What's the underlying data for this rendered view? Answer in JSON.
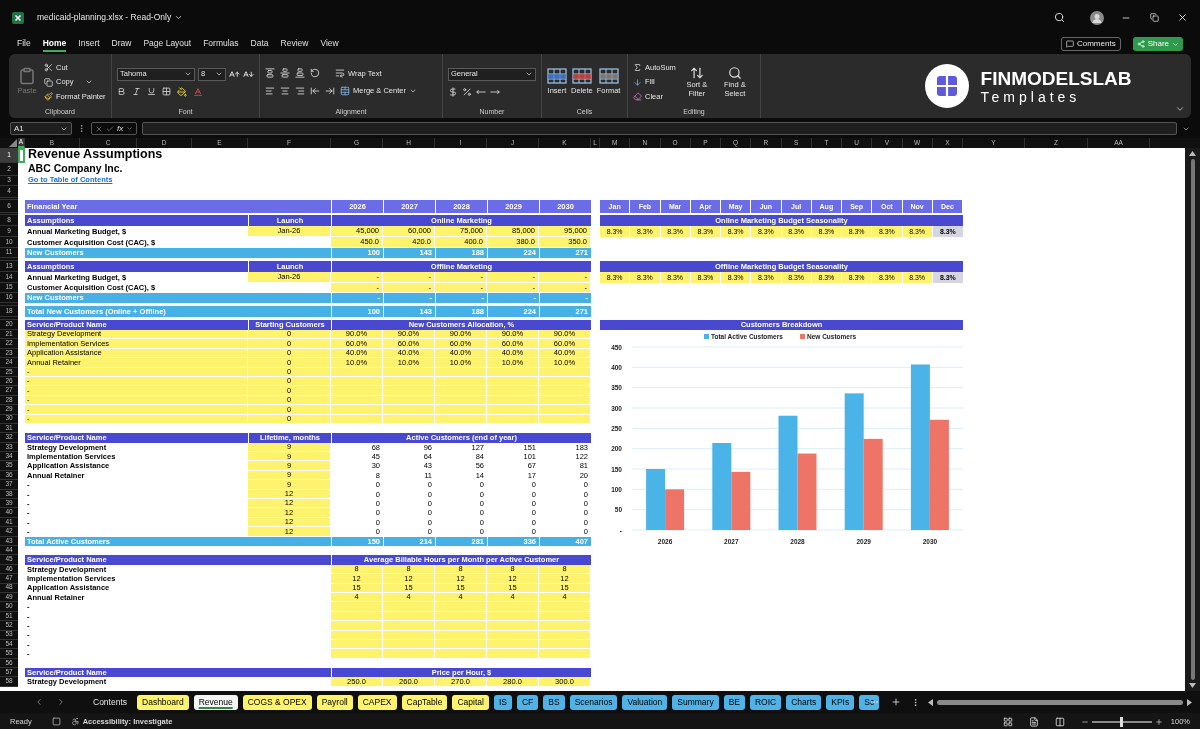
{
  "window": {
    "title": "medicaid-planning.xlsx - Read-Only"
  },
  "menu_tabs": [
    {
      "label": "File",
      "selected": false
    },
    {
      "label": "Home",
      "selected": true
    },
    {
      "label": "Insert",
      "selected": false
    },
    {
      "label": "Draw",
      "selected": false
    },
    {
      "label": "Page Layout",
      "selected": false
    },
    {
      "label": "Formulas",
      "selected": false
    },
    {
      "label": "Data",
      "selected": false
    },
    {
      "label": "Review",
      "selected": false
    },
    {
      "label": "View",
      "selected": false
    }
  ],
  "header_buttons": {
    "comments": "Comments",
    "share": "Share"
  },
  "ribbon": {
    "clipboard": {
      "label": "Clipboard",
      "paste": "Paste",
      "cut": "Cut",
      "copy": "Copy",
      "format_painter": "Format Painter"
    },
    "font": {
      "label": "Font",
      "font_name": "Tahoma",
      "font_size": "8"
    },
    "alignment": {
      "label": "Alignment",
      "wrap": "Wrap Text",
      "merge": "Merge & Center"
    },
    "number": {
      "label": "Number",
      "format": "General"
    },
    "cells": {
      "label": "Cells",
      "buttons": [
        "Insert",
        "Delete",
        "Format"
      ]
    },
    "editing": {
      "label": "Editing",
      "autosum": "AutoSum",
      "fill": "Fill",
      "clear": "Clear",
      "sort": "Sort & Filter",
      "find": "Find & Select"
    }
  },
  "logo": {
    "name": "FINMODELSLAB",
    "tagline": "Templates"
  },
  "formula_bar": {
    "name_box": "A1",
    "function_button": "fx"
  },
  "columns": [
    {
      "letter": "A",
      "selected": true
    },
    {
      "letter": "B",
      "selected": false
    },
    {
      "letter": "C",
      "selected": false
    },
    {
      "letter": "D",
      "selected": false
    },
    {
      "letter": "E",
      "selected": false
    },
    {
      "letter": "F",
      "selected": false
    },
    {
      "letter": "G",
      "selected": false
    },
    {
      "letter": "H",
      "selected": false
    },
    {
      "letter": "I",
      "selected": false
    },
    {
      "letter": "J",
      "selected": false
    },
    {
      "letter": "K",
      "selected": false
    },
    {
      "letter": "L",
      "selected": false
    },
    {
      "letter": "M",
      "selected": false
    },
    {
      "letter": "N",
      "selected": false
    },
    {
      "letter": "O",
      "selected": false
    },
    {
      "letter": "P",
      "selected": false
    },
    {
      "letter": "Q",
      "selected": false
    },
    {
      "letter": "R",
      "selected": false
    },
    {
      "letter": "S",
      "selected": false
    },
    {
      "letter": "T",
      "selected": false
    },
    {
      "letter": "U",
      "selected": false
    },
    {
      "letter": "V",
      "selected": false
    },
    {
      "letter": "W",
      "selected": false
    },
    {
      "letter": "X",
      "selected": false
    },
    {
      "letter": "Y",
      "selected": false
    },
    {
      "letter": "Z",
      "selected": false
    },
    {
      "letter": "AA",
      "selected": false
    }
  ],
  "rows": [
    {
      "number": "1",
      "selected": true,
      "kind": "title",
      "text": "Revenue Assumptions"
    },
    {
      "number": "2",
      "selected": false,
      "kind": "subtitle",
      "text": "ABC Company Inc."
    },
    {
      "number": "3",
      "selected": false,
      "kind": "link",
      "text": "Go to Table of Contents"
    },
    {
      "number": "4",
      "selected": false,
      "kind": "blank"
    },
    {
      "selected": false,
      "kind": "hidden"
    },
    {
      "number": "6",
      "selected": false,
      "kind": "year_bar",
      "label": "Financial Year",
      "values": [
        "2026",
        "2027",
        "2028",
        "2029",
        "2030"
      ],
      "right": {
        "kind": "months",
        "values": [
          "Jan",
          "Feb",
          "Mar",
          "Apr",
          "May",
          "Jun",
          "Jul",
          "Aug",
          "Sep",
          "Oct",
          "Nov",
          "Dec"
        ]
      }
    },
    {
      "selected": false,
      "kind": "hidden"
    },
    {
      "number": "8",
      "selected": false,
      "kind": "header",
      "label": "Assumptions",
      "f": "Launch",
      "title": "Online Marketing",
      "right": {
        "kind": "title",
        "text": "Online Marketing Budget Seasonality"
      }
    },
    {
      "number": "9",
      "selected": false,
      "kind": "input",
      "label": "Annual Marketing Budget, $",
      "f": "Jan-26",
      "values": [
        "45,000",
        "60,000",
        "75,000",
        "85,000",
        "95,000"
      ],
      "right": {
        "kind": "seasonality",
        "values": [
          "8.3%",
          "8.3%",
          "8.3%",
          "8.3%",
          "8.3%",
          "8.3%",
          "8.3%",
          "8.3%",
          "8.3%",
          "8.3%",
          "8.3%"
        ],
        "balance": "8.3%"
      }
    },
    {
      "number": "10",
      "selected": false,
      "kind": "input",
      "label": "Customer Acquisition Cost (CAC), $",
      "values": [
        "450.0",
        "420.0",
        "400.0",
        "380.0",
        "350.0"
      ]
    },
    {
      "number": "11",
      "selected": false,
      "kind": "total",
      "label": "New Customers",
      "values": [
        "100",
        "143",
        "188",
        "224",
        "271"
      ]
    },
    {
      "selected": false,
      "kind": "hidden"
    },
    {
      "number": "13",
      "selected": false,
      "kind": "header",
      "label": "Assumptions",
      "f": "Launch",
      "title": "Offline Marketing",
      "right": {
        "kind": "title",
        "text": "Offline Marketing Budget Seasonality"
      }
    },
    {
      "number": "14",
      "selected": false,
      "kind": "input",
      "label": "Annual Marketing Budget, $",
      "f": "Jan-26",
      "values": [
        "-",
        "-",
        "-",
        "-",
        "-"
      ],
      "right": {
        "kind": "seasonality",
        "values": [
          "8.3%",
          "8.3%",
          "8.3%",
          "8.3%",
          "8.3%",
          "8.3%",
          "8.3%",
          "8.3%",
          "8.3%",
          "8.3%",
          "8.3%"
        ],
        "balance": "8.3%"
      }
    },
    {
      "number": "15",
      "selected": false,
      "kind": "input",
      "label": "Customer Acquisition Cost (CAC), $",
      "values": [
        "-",
        "-",
        "-",
        "-",
        "-"
      ]
    },
    {
      "number": "16",
      "selected": false,
      "kind": "total",
      "label": "New Customers",
      "values": [
        "-",
        "-",
        "-",
        "-",
        "-"
      ]
    },
    {
      "selected": false,
      "kind": "hidden"
    },
    {
      "number": "18",
      "selected": false,
      "kind": "total",
      "label": "Total New Customers (Online + Offline)",
      "values": [
        "100",
        "143",
        "188",
        "224",
        "271"
      ]
    },
    {
      "selected": false,
      "kind": "hidden"
    },
    {
      "number": "20",
      "selected": false,
      "kind": "header",
      "label": "Service/Product Name",
      "f": "Starting Customers",
      "title": "New Customers Allocation, %",
      "right": {
        "kind": "title",
        "text": "Customers Breakdown"
      }
    },
    {
      "number": "21",
      "selected": false,
      "kind": "alloc",
      "label": "Strategy Development",
      "f": "0",
      "values": [
        "90.0%",
        "90.0%",
        "90.0%",
        "90.0%",
        "90.0%"
      ]
    },
    {
      "number": "22",
      "selected": false,
      "kind": "alloc",
      "label": "Implementation Services",
      "f": "0",
      "values": [
        "60.0%",
        "60.0%",
        "60.0%",
        "60.0%",
        "60.0%"
      ]
    },
    {
      "number": "23",
      "selected": false,
      "kind": "alloc",
      "label": "Application Assistance",
      "f": "0",
      "values": [
        "40.0%",
        "40.0%",
        "40.0%",
        "40.0%",
        "40.0%"
      ]
    },
    {
      "number": "24",
      "selected": false,
      "kind": "alloc",
      "label": "Annual Retainer",
      "f": "0",
      "values": [
        "10.0%",
        "10.0%",
        "10.0%",
        "10.0%",
        "10.0%"
      ]
    },
    {
      "number": "25",
      "selected": false,
      "kind": "alloc",
      "label": "-",
      "f": "0"
    },
    {
      "number": "26",
      "selected": false,
      "kind": "alloc",
      "label": "-",
      "f": "0"
    },
    {
      "number": "27",
      "selected": false,
      "kind": "alloc",
      "label": "-",
      "f": "0"
    },
    {
      "number": "28",
      "selected": false,
      "kind": "alloc",
      "label": "-",
      "f": "0"
    },
    {
      "number": "29",
      "selected": false,
      "kind": "alloc",
      "label": "-",
      "f": "0"
    },
    {
      "number": "30",
      "selected": false,
      "kind": "alloc",
      "label": "-",
      "f": "0"
    },
    {
      "number": "31",
      "selected": false,
      "kind": "blank"
    },
    {
      "number": "32",
      "selected": false,
      "kind": "header",
      "label": "Service/Product Name",
      "f": "Lifetime, months",
      "title": "Active Customers (end of year)"
    },
    {
      "number": "33",
      "selected": false,
      "kind": "active",
      "label": "Strategy Development",
      "f": "9",
      "values": [
        "68",
        "96",
        "127",
        "151",
        "183"
      ]
    },
    {
      "number": "34",
      "selected": false,
      "kind": "active",
      "label": "Implementation Services",
      "f": "9",
      "values": [
        "45",
        "64",
        "84",
        "101",
        "122"
      ]
    },
    {
      "number": "35",
      "selected": false,
      "kind": "active",
      "label": "Application Assistance",
      "f": "9",
      "values": [
        "30",
        "43",
        "56",
        "67",
        "81"
      ]
    },
    {
      "number": "36",
      "selected": false,
      "kind": "active",
      "label": "Annual Retainer",
      "f": "9",
      "values": [
        "8",
        "11",
        "14",
        "17",
        "20"
      ]
    },
    {
      "number": "37",
      "selected": false,
      "kind": "active",
      "label": "-",
      "f": "9",
      "values": [
        "0",
        "0",
        "0",
        "0",
        "0"
      ]
    },
    {
      "number": "38",
      "selected": false,
      "kind": "active",
      "label": "-",
      "f": "12",
      "values": [
        "0",
        "0",
        "0",
        "0",
        "0"
      ]
    },
    {
      "number": "39",
      "selected": false,
      "kind": "active",
      "label": "-",
      "f": "12",
      "values": [
        "0",
        "0",
        "0",
        "0",
        "0"
      ]
    },
    {
      "number": "40",
      "selected": false,
      "kind": "active",
      "label": "-",
      "f": "12",
      "values": [
        "0",
        "0",
        "0",
        "0",
        "0"
      ]
    },
    {
      "number": "41",
      "selected": false,
      "kind": "active",
      "label": "-",
      "f": "12",
      "values": [
        "0",
        "0",
        "0",
        "0",
        "0"
      ]
    },
    {
      "number": "42",
      "selected": false,
      "kind": "active",
      "label": "-",
      "f": "12",
      "values": [
        "0",
        "0",
        "0",
        "0",
        "0"
      ]
    },
    {
      "number": "43",
      "selected": false,
      "kind": "total",
      "label": "Total Active Customers",
      "values": [
        "150",
        "214",
        "281",
        "336",
        "407"
      ]
    },
    {
      "number": "44",
      "selected": false,
      "kind": "blank"
    },
    {
      "number": "45",
      "selected": false,
      "kind": "header",
      "label": "Service/Product Name",
      "title": "Average Billable Hours per Month per Active Customer"
    },
    {
      "number": "46",
      "selected": false,
      "kind": "hours",
      "label": "Strategy Development",
      "values": [
        "8",
        "8",
        "8",
        "8",
        "8"
      ]
    },
    {
      "number": "47",
      "selected": false,
      "kind": "hours",
      "label": "Implementation Services",
      "values": [
        "12",
        "12",
        "12",
        "12",
        "12"
      ]
    },
    {
      "number": "48",
      "selected": false,
      "kind": "hours",
      "label": "Application Assistance",
      "values": [
        "15",
        "15",
        "15",
        "15",
        "15"
      ]
    },
    {
      "number": "49",
      "selected": false,
      "kind": "hours",
      "label": "Annual Retainer",
      "values": [
        "4",
        "4",
        "4",
        "4",
        "4"
      ]
    },
    {
      "number": "50",
      "selected": false,
      "kind": "hours",
      "label": "-"
    },
    {
      "number": "51",
      "selected": false,
      "kind": "hours",
      "label": "-"
    },
    {
      "number": "52",
      "selected": false,
      "kind": "hours",
      "label": "-"
    },
    {
      "number": "53",
      "selected": false,
      "kind": "hours",
      "label": "-"
    },
    {
      "number": "54",
      "selected": false,
      "kind": "hours",
      "label": "-"
    },
    {
      "number": "55",
      "selected": false,
      "kind": "hours",
      "label": "-"
    },
    {
      "number": "56",
      "selected": false,
      "kind": "blank"
    },
    {
      "number": "57",
      "selected": false,
      "kind": "header",
      "label": "Service/Product Name",
      "title": "Price per Hour, $"
    },
    {
      "number": "58",
      "selected": false,
      "kind": "hours",
      "label": "Strategy Development",
      "values": [
        "250.0",
        "260.0",
        "270.0",
        "280.0",
        "300.0"
      ]
    }
  ],
  "chart": {
    "chart_data": {
      "type": "bar",
      "categories": [
        "2026",
        "2027",
        "2028",
        "2029",
        "2030"
      ],
      "series": [
        {
          "name": "Total Active Customers",
          "color": "#4ab3e8",
          "values": [
            150,
            214,
            281,
            336,
            407
          ]
        },
        {
          "name": "New Customers",
          "color": "#ef7468",
          "values": [
            100,
            143,
            188,
            224,
            271
          ]
        }
      ],
      "ylim": [
        0,
        450
      ],
      "grid": true,
      "legend": true,
      "yticks": [
        {
          "value": 0,
          "label": "-"
        },
        {
          "value": 50,
          "label": "50"
        },
        {
          "value": 100,
          "label": "100"
        },
        {
          "value": 150,
          "label": "150"
        },
        {
          "value": 200,
          "label": "200"
        },
        {
          "value": 250,
          "label": "250"
        },
        {
          "value": 300,
          "label": "300"
        },
        {
          "value": 350,
          "label": "350"
        },
        {
          "value": 400,
          "label": "400"
        },
        {
          "value": 450,
          "label": "450"
        }
      ]
    }
  },
  "sheet_tabs": [
    {
      "label": "Contents",
      "selected": false
    },
    {
      "label": "Dashboard",
      "color": "#fff36e",
      "selected": false
    },
    {
      "label": "Revenue",
      "selected": true
    },
    {
      "label": "COGS & OPEX",
      "color": "#fff36e",
      "selected": false
    },
    {
      "label": "Payroll",
      "color": "#fff36e",
      "selected": false
    },
    {
      "label": "CAPEX",
      "color": "#fff36e",
      "selected": false
    },
    {
      "label": "CapTable",
      "color": "#fff36e",
      "selected": false
    },
    {
      "label": "Capital",
      "color": "#fff36e",
      "selected": false
    },
    {
      "label": "IS",
      "color": "#4fb3e8",
      "selected": false
    },
    {
      "label": "CF",
      "color": "#4fb3e8",
      "selected": false
    },
    {
      "label": "BS",
      "color": "#4fb3e8",
      "selected": false
    },
    {
      "label": "Scenarios",
      "color": "#4fb3e8",
      "selected": false
    },
    {
      "label": "Valuation",
      "color": "#4fb3e8",
      "selected": false
    },
    {
      "label": "Summary",
      "color": "#4fb3e8",
      "selected": false
    },
    {
      "label": "BE",
      "color": "#4fb3e8",
      "selected": false
    },
    {
      "label": "ROIC",
      "color": "#4fb3e8",
      "selected": false
    },
    {
      "label": "Charts",
      "color": "#4fb3e8",
      "selected": false
    },
    {
      "label": "KPIs",
      "color": "#4fb3e8",
      "selected": false
    },
    {
      "label": "Sc",
      "color": "#4fb3e8",
      "selected": false
    }
  ],
  "status_bar": {
    "ready": "Ready",
    "accessibility": "Accessibility: Investigate",
    "zoom": "100%",
    "zoom_slider": {
      "level": 0.5
    }
  }
}
